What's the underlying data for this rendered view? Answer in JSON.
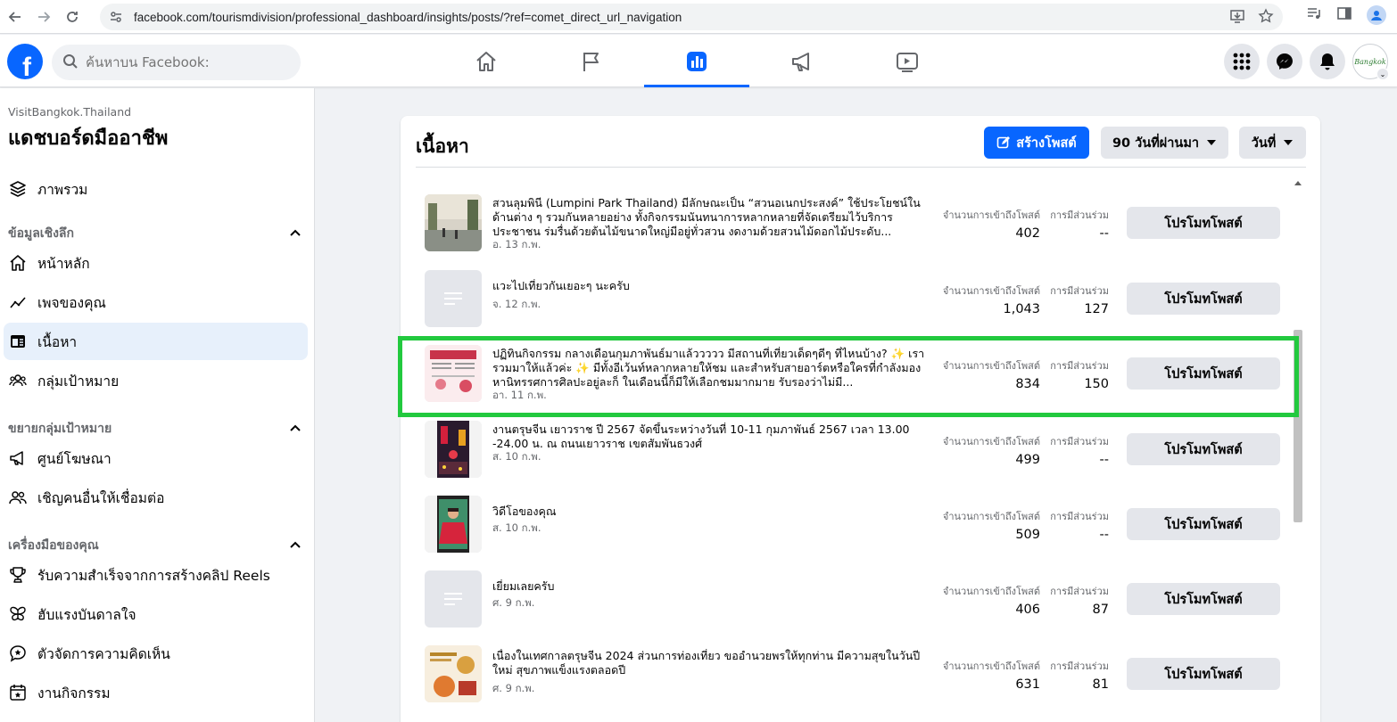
{
  "browser": {
    "url": "facebook.com/tourismdivision/professional_dashboard/insights/posts/?ref=comet_direct_url_navigation"
  },
  "fb": {
    "search_placeholder": "ค้นหาบน Facebook:",
    "avatar_text": "Bangkok"
  },
  "sidebar": {
    "page_name": "VisitBangkok.Thailand",
    "title": "แดชบอร์ดมืออาชีพ",
    "overview": "ภาพรวม",
    "sections": [
      {
        "label": "ข้อมูลเชิงลึก"
      },
      {
        "label": "ขยายกลุ่มเป้าหมาย"
      },
      {
        "label": "เครื่องมือของคุณ"
      }
    ],
    "items": [
      {
        "label": "หน้าหลัก"
      },
      {
        "label": "เพจของคุณ"
      },
      {
        "label": "เนื้อหา"
      },
      {
        "label": "กลุ่มเป้าหมาย"
      },
      {
        "label": "ศูนย์โฆษณา"
      },
      {
        "label": "เชิญคนอื่นให้เชื่อมต่อ"
      },
      {
        "label": "รับความสำเร็จจากการสร้างคลิป Reels"
      },
      {
        "label": "ฮับแรงบันดาลใจ"
      },
      {
        "label": "ตัวจัดการความคิดเห็น"
      },
      {
        "label": "งานกิจกรรม"
      }
    ]
  },
  "content": {
    "title": "เนื้อหา",
    "create_label": "สร้างโพสต์",
    "range_label": "90 วันที่ผ่านมา",
    "sort_label": "วันที่",
    "reach_label": "จำนวนการเข้าถึงโพสต์",
    "engagement_label": "การมีส่วนร่วม",
    "promote_label": "โปรโมทโพสต์",
    "posts": [
      {
        "text": "สวนลุมพินี (Lumpini Park Thailand) มีลักษณะเป็น “สวนอเนกประสงค์” ใช้ประโยชน์ในด้านต่าง ๆ รวมกันหลายอย่าง ทั้งกิจกรรมนันทนาการหลากหลายที่จัดเตรียมไว้บริการประชาชน ร่มรื่นด้วยต้นไม้ขนาดใหญ่มีอยู่ทั่วสวน งดงามด้วยสวนไม้ดอกไม้ประดับ...",
        "date": "อ. 13 ก.พ.",
        "reach": "402",
        "engagement": "--"
      },
      {
        "text": "แวะไปเที่ยวกันเยอะๆ นะครับ",
        "date": "จ. 12 ก.พ.",
        "reach": "1,043",
        "engagement": "127"
      },
      {
        "text": "ปฏิทินกิจกรรม กลางเดือนกุมภาพันธ์มาแล้ววววว มีสถานที่เที่ยวเด็ดๆดีๆ ที่ไหนบ้าง? ✨ เรารวมมาให้แล้วค่ะ ✨ มีทั้งอีเว้นท์หลากหลายให้ชม และสำหรับสายอาร์ตหรือใครที่กำลังมองหานิทรรศการศิลปะอยู่ละก็ ในเดือนนี้ก็มีให้เลือกชมมากมาย รับรองว่าไม่มี...",
        "date": "อา. 11 ก.พ.",
        "reach": "834",
        "engagement": "150"
      },
      {
        "text": "งานตรุษจีน เยาวราช ปี 2567 จัดขึ้นระหว่างวันที่ 10-11 กุมภาพันธ์ 2567 เวลา 13.00 -24.00 น. ณ ถนนเยาวราช เขตสัมพันธวงศ์",
        "date": "ส. 10 ก.พ.",
        "reach": "499",
        "engagement": "--"
      },
      {
        "text": "วิดีโอของคุณ",
        "date": "ส. 10 ก.พ.",
        "reach": "509",
        "engagement": "--"
      },
      {
        "text": "เยี่ยมเลยครับ",
        "date": "ศ. 9 ก.พ.",
        "reach": "406",
        "engagement": "87"
      },
      {
        "text": "เนื่องในเทศกาลตรุษจีน 2024 ส่วนการท่องเที่ยว ขออำนวยพรให้ทุกท่าน มีความสุขในวันปีใหม่ สุขภาพแข็งแรงตลอดปี",
        "date": "ศ. 9 ก.พ.",
        "reach": "631",
        "engagement": "81"
      }
    ]
  },
  "colors": {
    "fb_blue": "#0866ff",
    "highlight": "#22c93e"
  }
}
